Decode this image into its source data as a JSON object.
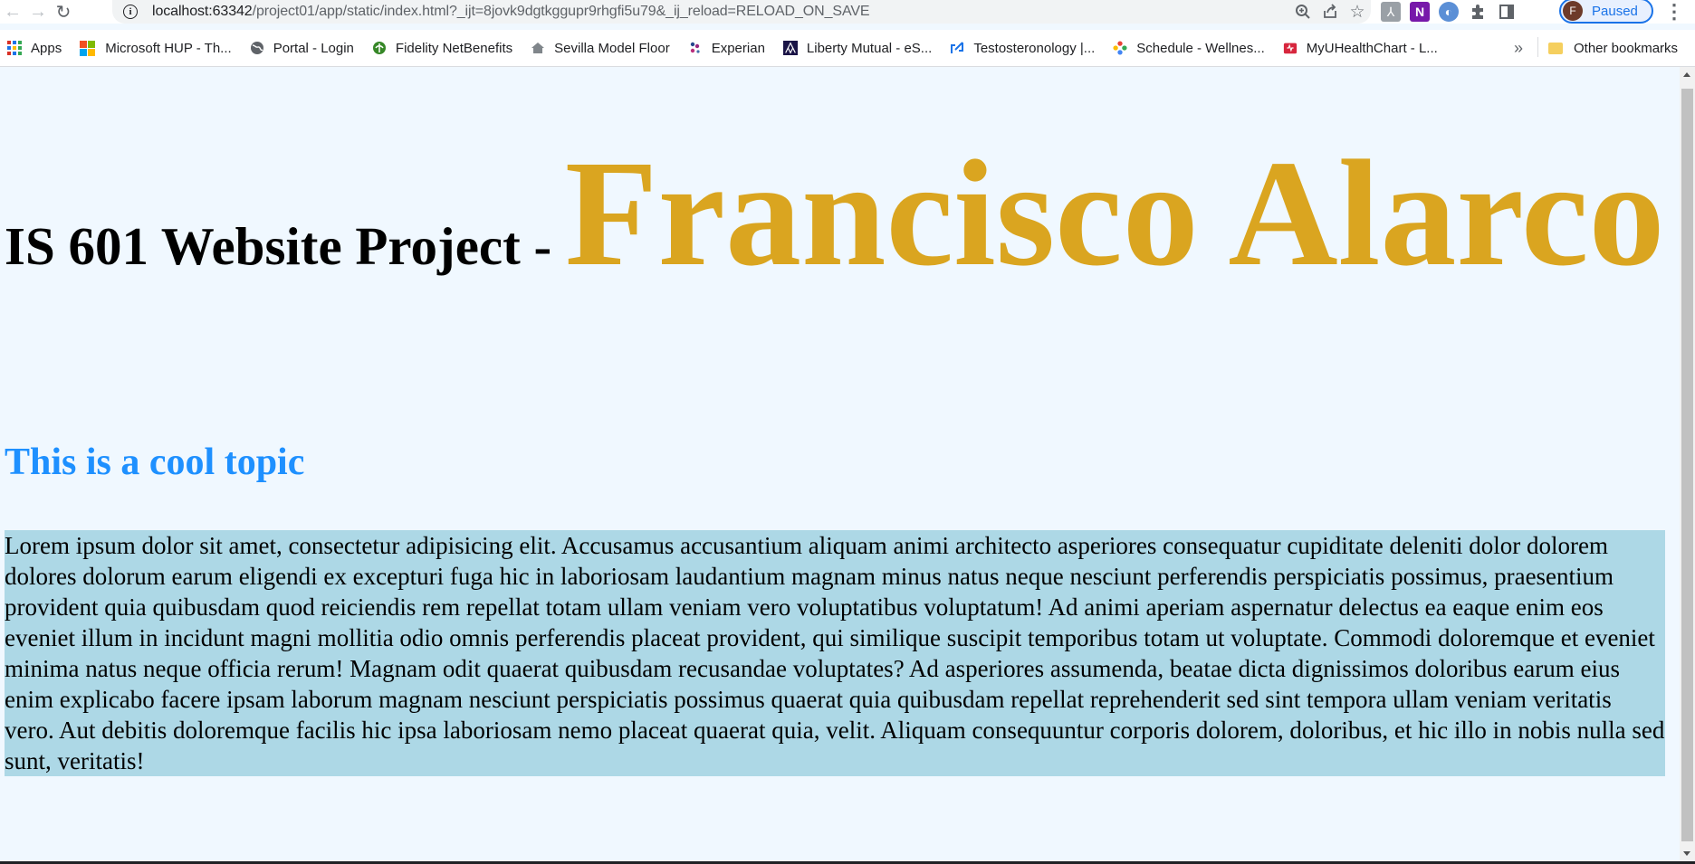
{
  "browser": {
    "url_host": "localhost:63342",
    "url_path": "/project01/app/static/index.html?_ijt=8jovk9dgtkggupr9rhgfi5u79&_ij_reload=RELOAD_ON_SAVE",
    "profile_initial": "F",
    "profile_status": "Paused",
    "icons": {
      "back": "back-arrow-icon",
      "forward": "forward-arrow-icon",
      "reload": "reload-icon",
      "site_info": "info-icon",
      "zoom": "zoom-icon",
      "share": "share-icon",
      "bookmark": "star-icon",
      "extensions": "puzzle-icon",
      "side_panel": "side-panel-icon",
      "menu": "kebab-menu-icon"
    }
  },
  "bookmarks": {
    "items": [
      {
        "label": "Apps",
        "icon": "apps-grid-icon"
      },
      {
        "label": "Microsoft HUP - Th...",
        "icon": "microsoft-logo-icon"
      },
      {
        "label": "Portal - Login",
        "icon": "globe-icon"
      },
      {
        "label": "Fidelity NetBenefits",
        "icon": "fidelity-icon"
      },
      {
        "label": "Sevilla Model Floor",
        "icon": "home-icon"
      },
      {
        "label": "Experian",
        "icon": "experian-icon"
      },
      {
        "label": "Liberty Mutual - eS...",
        "icon": "liberty-icon"
      },
      {
        "label": "Testosteronology |...",
        "icon": "link-icon"
      },
      {
        "label": "Schedule - Wellnes...",
        "icon": "flower-icon"
      },
      {
        "label": "MyUHealthChart - L...",
        "icon": "health-chart-icon"
      }
    ],
    "overflow": "»",
    "other_label": "Other bookmarks"
  },
  "page": {
    "title_prefix": "IS 601 Website Project - ",
    "title_name": "Francisco Alarco",
    "subtitle": "This is a cool topic",
    "paragraph": "Lorem ipsum dolor sit amet, consectetur adipisicing elit. Accusamus accusantium aliquam animi architecto asperiores consequatur cupiditate deleniti dolor dolorem dolores dolorum earum eligendi ex excepturi fuga hic in laboriosam laudantium magnam minus natus neque nesciunt perferendis perspiciatis possimus, praesentium provident quia quibusdam quod reiciendis rem repellat totam ullam veniam vero voluptatibus voluptatum! Ad animi aperiam aspernatur delectus ea eaque enim eos eveniet illum in incidunt magni mollitia odio omnis perferendis placeat provident, qui similique suscipit temporibus totam ut voluptate. Commodi doloremque et eveniet minima natus neque officia rerum! Magnam odit quaerat quibusdam recusandae voluptates? Ad asperiores assumenda, beatae dicta dignissimos doloribus earum eius enim explicabo facere ipsam laborum magnam nesciunt perspiciatis possimus quaerat quia quibusdam repellat reprehenderit sed sint tempora ullam veniam veritatis vero. Aut debitis doloremque facilis hic ipsa laboriosam nemo placeat quaerat quia, velit. Aliquam consequuntur corporis dolorem, doloribus, et hic illo in nobis nulla sed sunt, veritatis!"
  },
  "colors": {
    "page_background": "#f0f8ff",
    "name_color": "#daa520",
    "subtitle_color": "#1e90ff",
    "paragraph_background": "#add8e6"
  }
}
